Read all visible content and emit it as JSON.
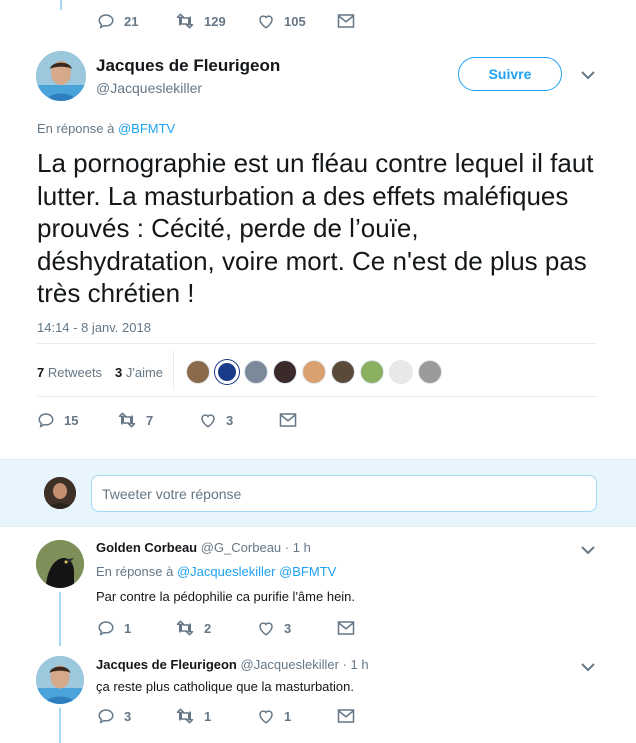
{
  "top_actions": {
    "replies": "21",
    "retweets": "129",
    "likes": "105"
  },
  "main_tweet": {
    "name": "Jacques de Fleurigeon",
    "handle": "@Jacqueslekiller",
    "follow_label": "Suivre",
    "reply_prefix": "En réponse à",
    "reply_to": "@BFMTV",
    "text": "La pornographie est un fléau contre lequel il faut lutter. La masturbation a des effets maléfiques prouvés : Cécité, perde de l’ouïe, déshydratation, voire mort. Ce n'est de plus pas très chrétien !",
    "timestamp": "14:14 - 8 janv. 2018",
    "retweets_count": "7",
    "retweets_label": "Retweets",
    "likes_count": "3",
    "likes_label": "J'aime",
    "actions": {
      "replies": "15",
      "retweets": "7",
      "likes": "3"
    }
  },
  "reply_box": {
    "placeholder": "Tweeter votre réponse"
  },
  "replies": [
    {
      "name": "Golden Corbeau",
      "handle": "@G_Corbeau",
      "time": "· 1 h",
      "reply_prefix": "En réponse à",
      "reply_to_1": "@Jacqueslekiller",
      "reply_to_2": "@BFMTV",
      "text": "Par contre la pédophilie ca purifie l'âme hein.",
      "actions": {
        "replies": "1",
        "retweets": "2",
        "likes": "3"
      }
    },
    {
      "name": "Jacques de Fleurigeon",
      "handle": "@Jacqueslekiller",
      "time": "· 1 h",
      "text": "ça reste plus catholique que la masturbation.",
      "actions": {
        "replies": "3",
        "retweets": "1",
        "likes": "1"
      }
    }
  ],
  "colors": {
    "accent": "#1da1f2",
    "thread": "#a4d9f5",
    "muted": "#657786",
    "divider": "#e6ecf0"
  }
}
